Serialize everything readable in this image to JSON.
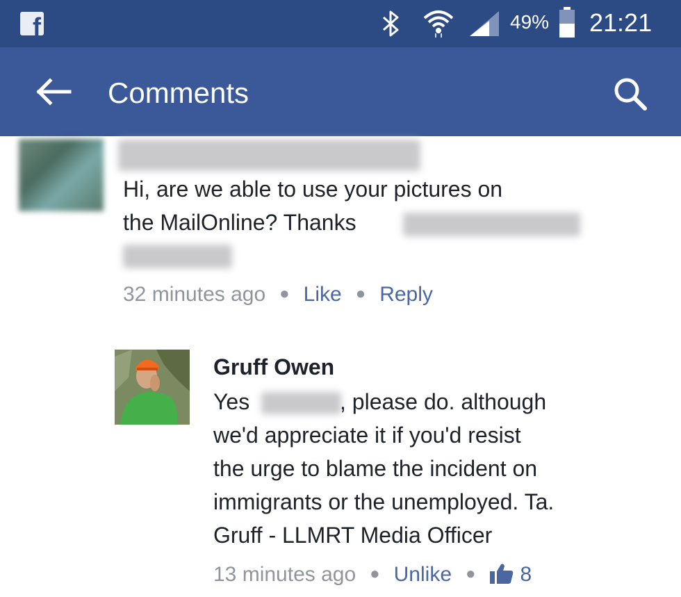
{
  "status_bar": {
    "battery": "49%",
    "time": "21:21"
  },
  "app_bar": {
    "title": "Comments"
  },
  "comments": [
    {
      "text_line1": "Hi, are we able to use your pictures on",
      "text_line2": "the MailOnline? Thanks",
      "time": "32 minutes ago",
      "like_label": "Like",
      "reply_label": "Reply"
    },
    {
      "author": "Gruff Owen",
      "text_line1_a": "Yes",
      "text_line1_b": ", please do. although",
      "text_line2": "we'd appreciate it if you'd resist",
      "text_line3": "the urge to blame the incident on",
      "text_line4": "immigrants or the unemployed. Ta.",
      "text_line5": "Gruff - LLMRT Media Officer",
      "time": "13 minutes ago",
      "unlike_label": "Unlike",
      "like_count": "8"
    }
  ],
  "colors": {
    "status_bar": "#2c4a84",
    "app_bar": "#3b5998",
    "link": "#4b67a1",
    "meta": "#90949c"
  }
}
